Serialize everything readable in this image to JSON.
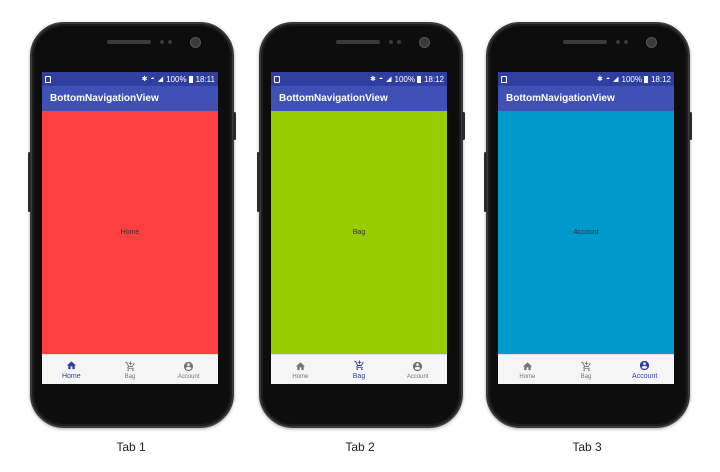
{
  "phones": [
    {
      "status": {
        "battery": "100%",
        "time": "18:11"
      },
      "app_title": "BottomNavigationView",
      "content": {
        "label": "Home",
        "color": "#fd3f3f"
      },
      "nav": {
        "items": [
          "Home",
          "Bag",
          "Account"
        ],
        "active": 0
      },
      "caption": "Tab 1"
    },
    {
      "status": {
        "battery": "100%",
        "time": "18:12"
      },
      "app_title": "BottomNavigationView",
      "content": {
        "label": "Bag",
        "color": "#99cc00"
      },
      "nav": {
        "items": [
          "Home",
          "Bag",
          "Account"
        ],
        "active": 1
      },
      "caption": "Tab 2"
    },
    {
      "status": {
        "battery": "100%",
        "time": "18:12"
      },
      "app_title": "BottomNavigationView",
      "content": {
        "label": "Account",
        "color": "#0099cc"
      },
      "nav": {
        "items": [
          "Home",
          "Bag",
          "Account"
        ],
        "active": 2
      },
      "caption": "Tab 3"
    }
  ],
  "icons": {
    "status": [
      "sim-icon",
      "bluetooth-icon",
      "wifi-icon",
      "signal-icon",
      "battery-icon"
    ],
    "nav": [
      "home-icon",
      "cart-icon",
      "account-icon"
    ]
  },
  "colors": {
    "statusbar": "#303f9f",
    "appbar": "#3f51b5",
    "nav_active": "#303f9f",
    "nav_inactive": "#757575"
  }
}
